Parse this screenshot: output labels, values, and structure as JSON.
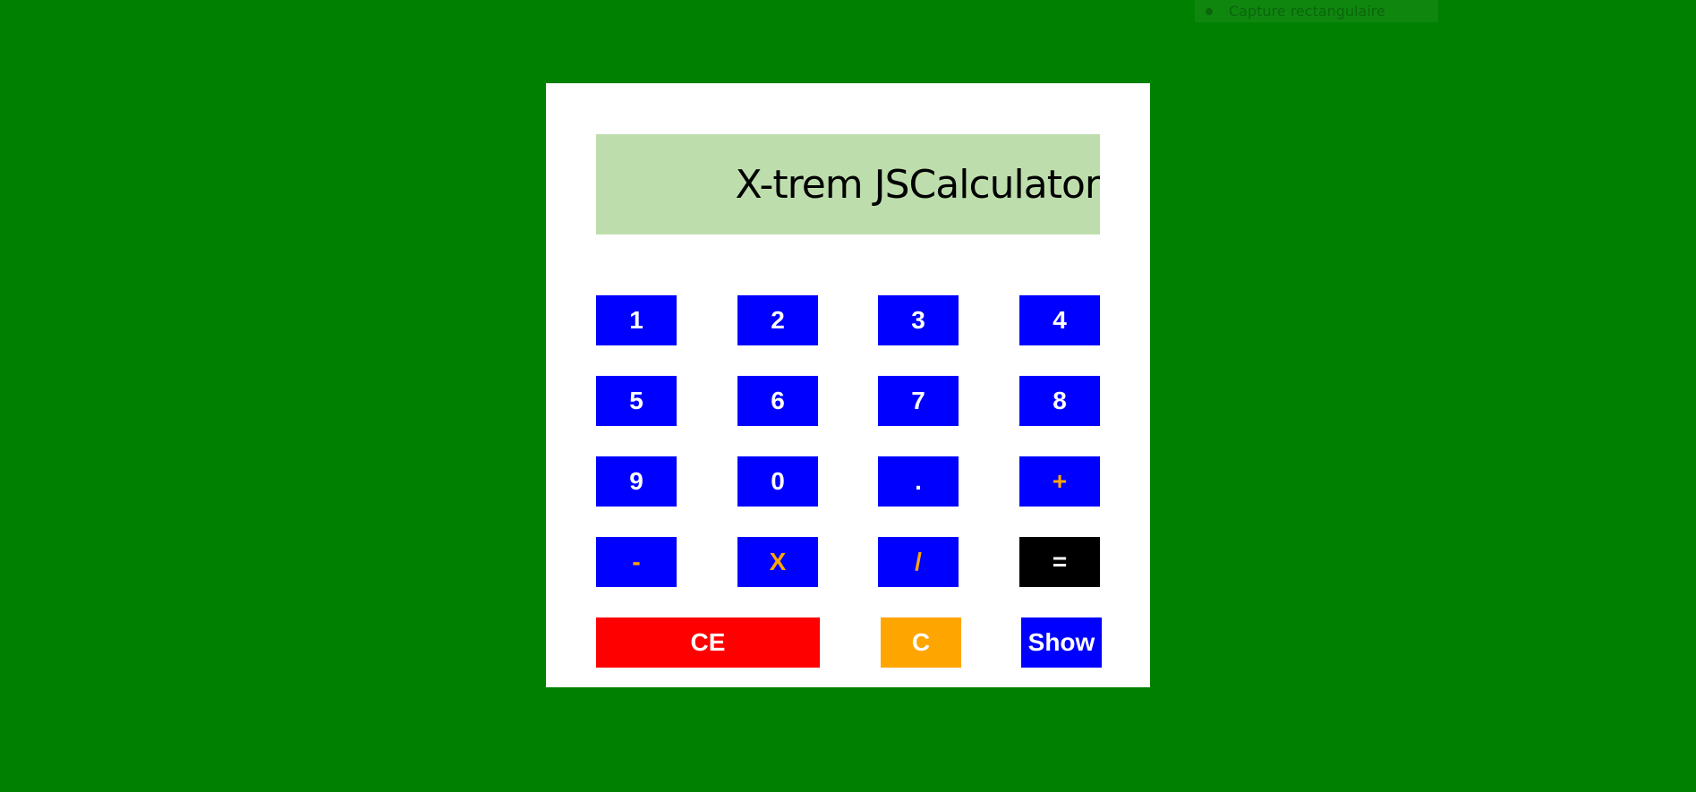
{
  "capture_bar": {
    "label": "Capture rectangulaire"
  },
  "display": {
    "text": "X-trem JSCalculator"
  },
  "keys": {
    "k1": "1",
    "k2": "2",
    "k3": "3",
    "k4": "4",
    "k5": "5",
    "k6": "6",
    "k7": "7",
    "k8": "8",
    "k9": "9",
    "k0": "0",
    "dot": ".",
    "plus": "+",
    "minus": "-",
    "multiply": "X",
    "divide": "/",
    "equals": "=",
    "ce": "CE",
    "c": "C",
    "show": "Show"
  },
  "colors": {
    "background": "#008000",
    "display_bg": "#bddeac",
    "number_key": "#0000ff",
    "operator_text": "#ffa500",
    "equals_key": "#000000",
    "ce_key": "#ff0000",
    "c_key": "#ffa500"
  }
}
